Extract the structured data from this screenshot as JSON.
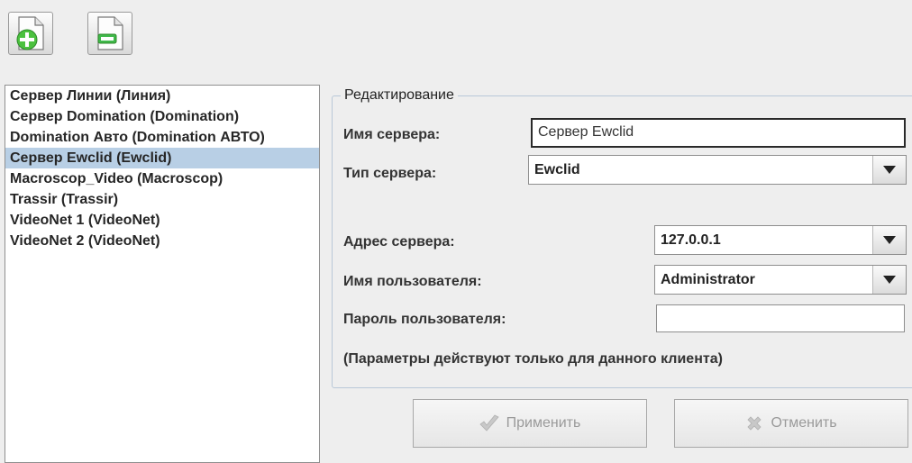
{
  "toolbar": {
    "add_icon": "add-document-icon",
    "remove_icon": "remove-document-icon"
  },
  "server_list": {
    "items": [
      "Сервер Линии (Линия)",
      "Сервер Domination (Domination)",
      "Domination Авто (Domination АВТО)",
      "Сервер Ewclid (Ewclid)",
      "Macroscop_Video (Macroscop)",
      "Trassir (Trassir)",
      "VideoNet 1 (VideoNet)",
      "VideoNet 2 (VideoNet)"
    ],
    "selected_index": 3
  },
  "editor": {
    "title": "Редактирование",
    "server_name_label": "Имя сервера:",
    "server_name_value": "Сервер Ewclid",
    "server_type_label": "Тип сервера:",
    "server_type_value": "Ewclid",
    "address_label": "Адрес сервера:",
    "address_value": "127.0.0.1",
    "username_label": "Имя пользователя:",
    "username_value": "Administrator",
    "password_label": "Пароль пользователя:",
    "password_value": "",
    "note": "(Параметры действуют только для данного клиента)"
  },
  "actions": {
    "apply_label": "Применить",
    "cancel_label": "Отменить"
  },
  "colors": {
    "selection": "#b8cfe5",
    "add_green": "#4cc13f",
    "remove_green": "#3fb84a"
  }
}
